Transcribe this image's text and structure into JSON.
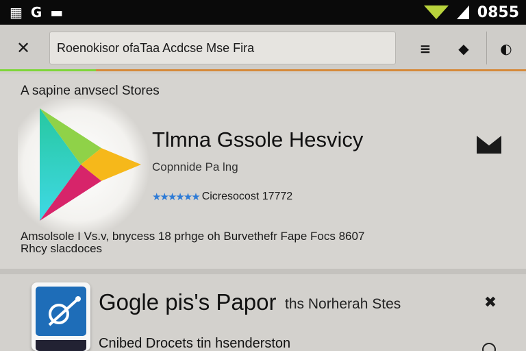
{
  "status_bar": {
    "left_icons": [
      "grid-icon",
      "g-icon",
      "message-icon"
    ],
    "left_glyphs": [
      "▦",
      "G",
      "▬"
    ],
    "time": "0855"
  },
  "toolbar": {
    "search_value": "Roenokisor ofaTaa Acdcse Mse Fira",
    "nav_glyph": "✕",
    "menu_glyph": "≡",
    "pin_glyph": "◆",
    "back_glyph": "◐"
  },
  "featured": {
    "section_label": "A sapine anvsecl Stores",
    "title": "Tlmna Gssole Hesvicy",
    "subtitle": "Copnnide Pa lng",
    "stars": "★★★★★★",
    "rating_text": "Cicresocost 17772",
    "description_line1": "Amsolsole I Vs.v, bnycess 18 prhge oh Burvethefr Fape Focs 8607",
    "description_line2": "Rhcy slacdoces"
  },
  "item2": {
    "title": "Gogle pis's Papor",
    "meta": "ths Norherah Stes",
    "subtitle": "Cnibed Drocets tin hsenderston",
    "tool_glyph": "✖"
  },
  "colors": {
    "accent_progress": "#7fd63a",
    "underline": "#d68a3a",
    "star": "#2e7bd6"
  }
}
